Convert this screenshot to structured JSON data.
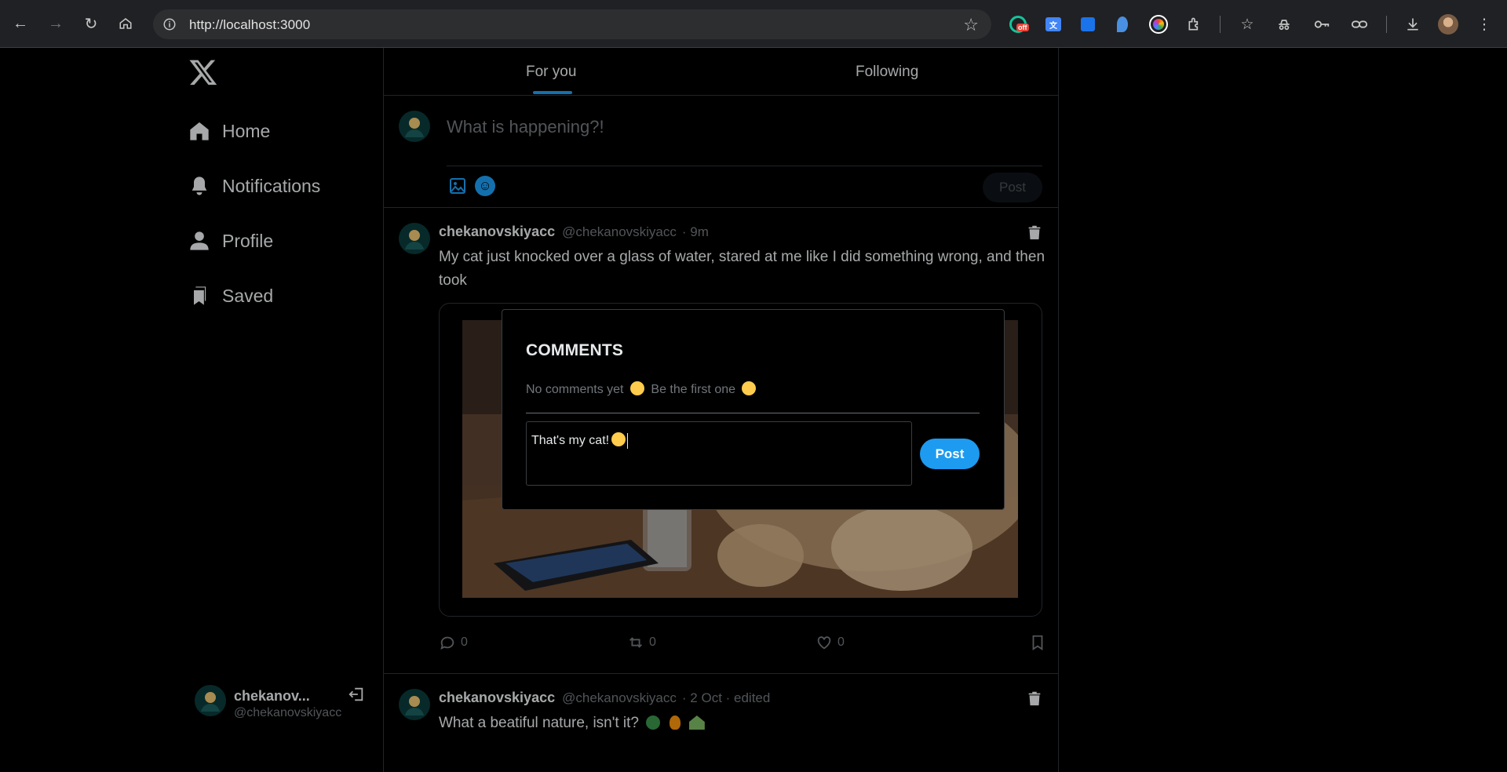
{
  "browser": {
    "url": "http://localhost:3000",
    "extension_badge": "off"
  },
  "sidebar": {
    "logo": "X",
    "items": [
      {
        "label": "Home",
        "icon": "home-icon"
      },
      {
        "label": "Notifications",
        "icon": "bell-icon"
      },
      {
        "label": "Profile",
        "icon": "person-icon"
      },
      {
        "label": "Saved",
        "icon": "bookmark-icon"
      }
    ],
    "account": {
      "name": "chekanov...",
      "handle": "@chekanovskiyacc"
    }
  },
  "feed": {
    "tabs": [
      {
        "label": "For you",
        "active": true
      },
      {
        "label": "Following",
        "active": false
      }
    ],
    "composer": {
      "placeholder": "What is happening?!",
      "post_label": "Post"
    },
    "tweets": [
      {
        "name": "chekanovskiyacc",
        "handle": "@chekanovskiyacc",
        "meta": "· 9m",
        "text": "My cat just knocked over a glass of water, stared at me like I did something wrong, and then took",
        "comments": "0",
        "reposts": "0",
        "likes": "0"
      },
      {
        "name": "chekanovskiyacc",
        "handle": "@chekanovskiyacc",
        "meta": "· 2 Oct · edited",
        "text": "What a beatiful nature, isn't it?"
      }
    ]
  },
  "modal": {
    "title": "COMMENTS",
    "empty_text_1": "No comments yet",
    "empty_text_2": "Be the first one",
    "input_value": "That's my cat!",
    "post_label": "Post"
  },
  "colors": {
    "accent": "#1d9bf0",
    "background": "#000000",
    "muted": "#71767b",
    "border": "#2f3336"
  }
}
